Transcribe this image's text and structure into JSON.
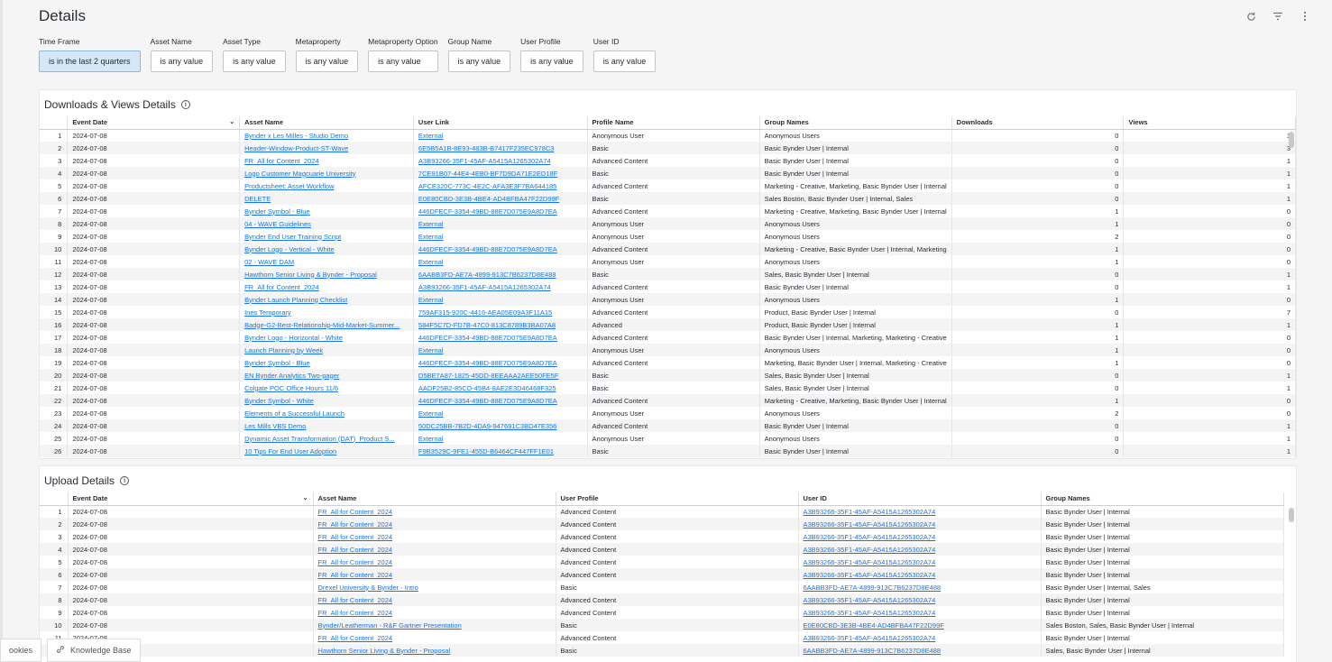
{
  "page": {
    "title": "Details"
  },
  "top_icons": [
    "refresh-icon",
    "filter-icon",
    "more-vertical-icon"
  ],
  "filters": [
    {
      "label": "Time Frame",
      "value": "is in the last 2 quarters",
      "active": true
    },
    {
      "label": "Asset Name",
      "value": "is any value"
    },
    {
      "label": "Asset Type",
      "value": "is any value"
    },
    {
      "label": "Metaproperty",
      "value": "is any value"
    },
    {
      "label": "Metaproperty Option",
      "value": "is any value"
    },
    {
      "label": "Group Name",
      "value": "is any value"
    },
    {
      "label": "User Profile",
      "value": "is any value"
    },
    {
      "label": "User ID",
      "value": "is any value"
    }
  ],
  "downloads": {
    "title": "Downloads & Views Details",
    "columns": [
      "Event Date",
      "Asset Name",
      "User Link",
      "Profile Name",
      "Group Names",
      "Downloads",
      "Views"
    ],
    "rows": [
      [
        "1",
        "2024-07-08",
        "Bynder x Les Milles - Studio Demo",
        "External",
        "Anonymous User",
        "Anonymous Users",
        "0",
        "1"
      ],
      [
        "2",
        "2024-07-08",
        "Header-Window-Product-ST-Wave",
        "6E5B5A1B-8E93-483B-B7417F235EC978C3",
        "Basic",
        "Basic Bynder User | Internal",
        "0",
        "3"
      ],
      [
        "3",
        "2024-07-08",
        "FR_All for Content_2024",
        "A3B93266-35F1-45AF-A5415A1265302A74",
        "Advanced Content",
        "Basic Bynder User | Internal",
        "0",
        "1"
      ],
      [
        "4",
        "2024-07-08",
        "Logo Customer Magcuarie University",
        "7CE91B07-44E4-4EB0-BF7D9DA71E2ED18F",
        "Basic",
        "Basic Bynder User | Internal",
        "0",
        "1"
      ],
      [
        "5",
        "2024-07-08",
        "Productsheet: Asset Workflow",
        "AFCE320C-773C-4E2C-AFA3E3F7BA644185",
        "Advanced Content",
        "Marketing - Creative, Marketing, Basic Bynder User | Internal",
        "0",
        "1"
      ],
      [
        "6",
        "2024-07-08",
        "DELETE",
        "E0E80CBD-3E3B-4BE4-AD4BFBA47F22D99F",
        "Basic",
        "Sales Boston, Basic Bynder User | Internal, Sales",
        "0",
        "1"
      ],
      [
        "7",
        "2024-07-08",
        "Bynder Symbol - Blue",
        "446DFECF-3354-49BD-88E7D075E9A8D7EA",
        "Advanced Content",
        "Marketing - Creative, Marketing, Basic Bynder User | Internal",
        "1",
        "0"
      ],
      [
        "8",
        "2024-07-08",
        "04 - WAVE Guidelines",
        "External",
        "Anonymous User",
        "Anonymous Users",
        "1",
        "0"
      ],
      [
        "9",
        "2024-07-08",
        "Bynder End User Training Script",
        "External",
        "Anonymous User",
        "Anonymous Users",
        "2",
        "0"
      ],
      [
        "10",
        "2024-07-08",
        "Bynder Logo - Vertical - White",
        "446DFECF-3354-49BD-88E7D075E9A8D7EA",
        "Advanced Content",
        "Marketing - Creative, Basic Bynder User | Internal, Marketing",
        "1",
        "0"
      ],
      [
        "11",
        "2024-07-08",
        "02 - WAVE DAM",
        "External",
        "Anonymous User",
        "Anonymous Users",
        "1",
        "0"
      ],
      [
        "12",
        "2024-07-08",
        "Hawthorn Senior Living & Bynder - Proposal",
        "6AABB3FD-AE7A-4899-913C7B6237D8E488",
        "Basic",
        "Sales, Basic Bynder User | Internal",
        "0",
        "1"
      ],
      [
        "13",
        "2024-07-08",
        "FR_All for Content_2024",
        "A3B93266-35F1-45AF-A5415A1265302A74",
        "Advanced Content",
        "Basic Bynder User | Internal",
        "0",
        "1"
      ],
      [
        "14",
        "2024-07-08",
        "Bynder Launch Planning Checklist",
        "External",
        "Anonymous User",
        "Anonymous Users",
        "1",
        "0"
      ],
      [
        "15",
        "2024-07-08",
        "Ines Temporary",
        "759AF315-920C-4416-AEA05E09A3F11A15",
        "Advanced Content",
        "Product, Basic Bynder User | Internal",
        "0",
        "7"
      ],
      [
        "16",
        "2024-07-08",
        "Badge-G2-Best-Relationship-Mid-Market-Summer...",
        "584F5C7D-FD7B-47C0-813C8789B3BA07A8",
        "Advanced",
        "Product, Basic Bynder User | Internal",
        "1",
        "1"
      ],
      [
        "17",
        "2024-07-08",
        "Bynder Logo - Horizontal - White",
        "446DFECF-3354-49BD-88E7D075E9A8D7EA",
        "Advanced Content",
        "Basic Bynder User | Internal, Marketing, Marketing - Creative",
        "1",
        "0"
      ],
      [
        "18",
        "2024-07-08",
        "Launch Planning by Week",
        "External",
        "Anonymous User",
        "Anonymous Users",
        "1",
        "0"
      ],
      [
        "19",
        "2024-07-08",
        "Bynder Symbol - Blue",
        "446DFECF-3354-49BD-88E7D075E9A8D7EA",
        "Advanced Content",
        "Marketing, Basic Bynder User | Internal, Marketing - Creative",
        "1",
        "0"
      ],
      [
        "20",
        "2024-07-08",
        "EN Bynder Analytics Two-pager",
        "D5BE7A87-1825-45DD-8EEAAA2AEE50FE5F",
        "Basic",
        "Sales, Basic Bynder User | Internal",
        "0",
        "1"
      ],
      [
        "21",
        "2024-07-08",
        "Colgate POC Office Hours 11/6",
        "AADF25B2-85CD-45B4-8AE2E3D46468F325",
        "Basic",
        "Sales, Basic Bynder User | Internal",
        "0",
        "1"
      ],
      [
        "22",
        "2024-07-08",
        "Bynder Symbol - White",
        "446DFECF-3354-49BD-88E7D075E9A8D7EA",
        "Advanced Content",
        "Marketing - Creative, Marketing, Basic Bynder User | Internal",
        "1",
        "0"
      ],
      [
        "23",
        "2024-07-08",
        "Elements of a Successful Launch",
        "External",
        "Anonymous User",
        "Anonymous Users",
        "2",
        "0"
      ],
      [
        "24",
        "2024-07-08",
        "Les Mills VBS Demo",
        "50DC25BB-7B2D-4DA9-947691C3BD47E356",
        "Advanced Content",
        "Basic Bynder User | Internal",
        "0",
        "1"
      ],
      [
        "25",
        "2024-07-08",
        "Dynamic Asset Transformation (DAT)_Product S...",
        "External",
        "Anonymous User",
        "Anonymous Users",
        "0",
        "1"
      ],
      [
        "26",
        "2024-07-08",
        "10 Tips For End User Adoption",
        "F9B3529C-9FE1-455D-B6464CF447FF1E01",
        "Basic",
        "Basic Bynder User | Internal",
        "0",
        "1"
      ]
    ]
  },
  "uploads": {
    "title": "Upload Details",
    "columns": [
      "Event Date",
      "Asset Name",
      "User Profile",
      "User ID",
      "Group Names"
    ],
    "rows": [
      [
        "1",
        "2024-07-08",
        "FR_All for Content_2024",
        "Advanced Content",
        "A3B93266-35F1-45AF-A5415A1265302A74",
        "Basic Bynder User | Internal"
      ],
      [
        "2",
        "2024-07-08",
        "FR_All for Content_2024",
        "Advanced Content",
        "A3B93266-35F1-45AF-A5415A1265302A74",
        "Basic Bynder User | Internal"
      ],
      [
        "3",
        "2024-07-08",
        "FR_All for Content_2024",
        "Advanced Content",
        "A3B93266-35F1-45AF-A5415A1265302A74",
        "Basic Bynder User | Internal"
      ],
      [
        "4",
        "2024-07-08",
        "FR_All for Content_2024",
        "Advanced Content",
        "A3B93266-35F1-45AF-A5415A1265302A74",
        "Basic Bynder User | Internal"
      ],
      [
        "5",
        "2024-07-08",
        "FR_All for Content_2024",
        "Advanced Content",
        "A3B93266-35F1-45AF-A5415A1265302A74",
        "Basic Bynder User | Internal"
      ],
      [
        "6",
        "2024-07-08",
        "FR_All for Content_2024",
        "Advanced Content",
        "A3B93266-35F1-45AF-A5415A1265302A74",
        "Basic Bynder User | Internal"
      ],
      [
        "7",
        "2024-07-08",
        "Drexel University & Bynder - Intro",
        "Basic",
        "6AABB3FD-AE7A-4899-913C7B6237D8E488",
        "Basic Bynder User | Internal, Sales"
      ],
      [
        "8",
        "2024-07-08",
        "FR_All for Content_2024",
        "Advanced Content",
        "A3B93266-35F1-45AF-A5415A1265302A74",
        "Basic Bynder User | Internal"
      ],
      [
        "9",
        "2024-07-08",
        "FR_All for Content_2024",
        "Advanced Content",
        "A3B93266-35F1-45AF-A5415A1265302A74",
        "Basic Bynder User | Internal"
      ],
      [
        "10",
        "2024-07-08",
        "Bynder/Leatherman - R&F Gartner Presentation",
        "Basic",
        "E0E80CBD-3E3B-4BE4-AD4BFBA47F22D99F",
        "Sales Boston, Sales, Basic Bynder User | Internal"
      ],
      [
        "11",
        "2024-07-08",
        "FR_All for Content_2024",
        "Advanced Content",
        "A3B93266-35F1-45AF-A5415A1265302A74",
        "Basic Bynder User | Internal"
      ],
      [
        "12",
        "2024-07-08",
        "Hawthorn Senior Living & Bynder - Proposal",
        "Basic",
        "6AABB3FD-AE7A-4899-913C7B6237D8E488",
        "Sales, Basic Bynder User | Internal"
      ]
    ]
  },
  "bottom": {
    "cookies": "ookies",
    "knowledge_base": "Knowledge Base"
  }
}
